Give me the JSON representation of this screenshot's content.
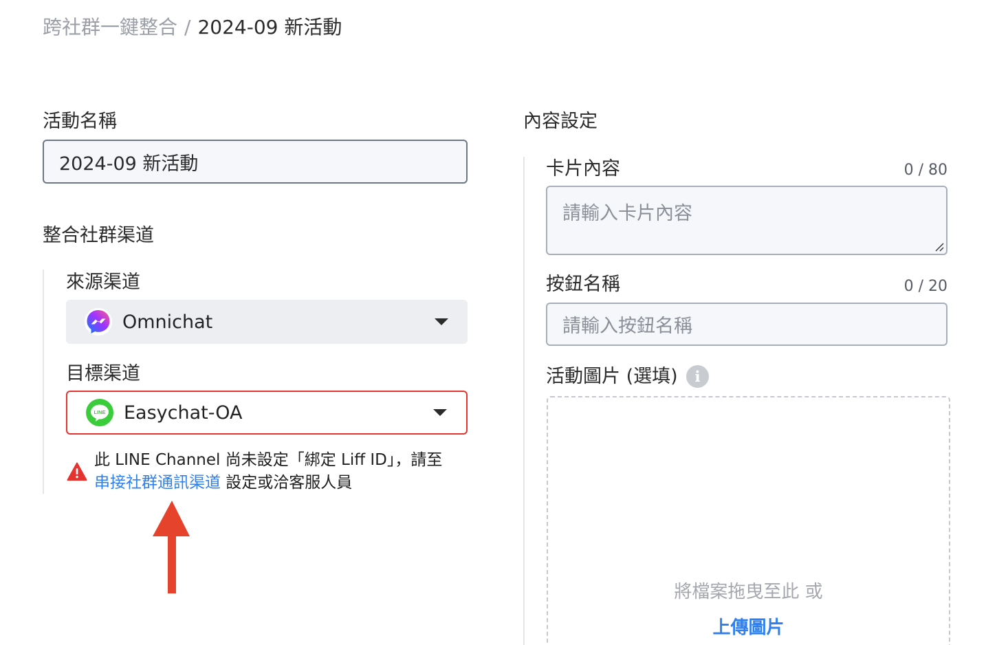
{
  "breadcrumb": {
    "parent": "跨社群一鍵整合",
    "separator": "/",
    "current": "2024-09 新活動"
  },
  "campaign": {
    "name_label": "活動名稱",
    "name_value": "2024-09 新活動"
  },
  "channels": {
    "section_title": "整合社群渠道",
    "source_label": "來源渠道",
    "source_value": "Omnichat",
    "source_icon": "messenger-icon",
    "target_label": "目標渠道",
    "target_value": "Easychat-OA",
    "target_icon": "line-icon",
    "line_icon_text": "LINE",
    "warning_text": "此 LINE Channel 尚未設定「綁定 Liff ID」，請至",
    "warning_link": "串接社群通訊渠道",
    "warning_suffix": " 設定或洽客服人員"
  },
  "content": {
    "section_title": "內容設定",
    "card_label": "卡片內容",
    "card_counter": "0 / 80",
    "card_placeholder": "請輸入卡片內容",
    "button_label": "按鈕名稱",
    "button_counter": "0 / 20",
    "button_placeholder": "請輸入按鈕名稱",
    "image_label": "活動圖片 (選填)",
    "info_symbol": "i",
    "drop_hint": "將檔案拖曳至此 或",
    "upload_link": "上傳圖片"
  },
  "colors": {
    "link": "#2f80ed",
    "error": "#e5332f",
    "arrow": "#e5432b",
    "line_green": "#3acc3a"
  }
}
